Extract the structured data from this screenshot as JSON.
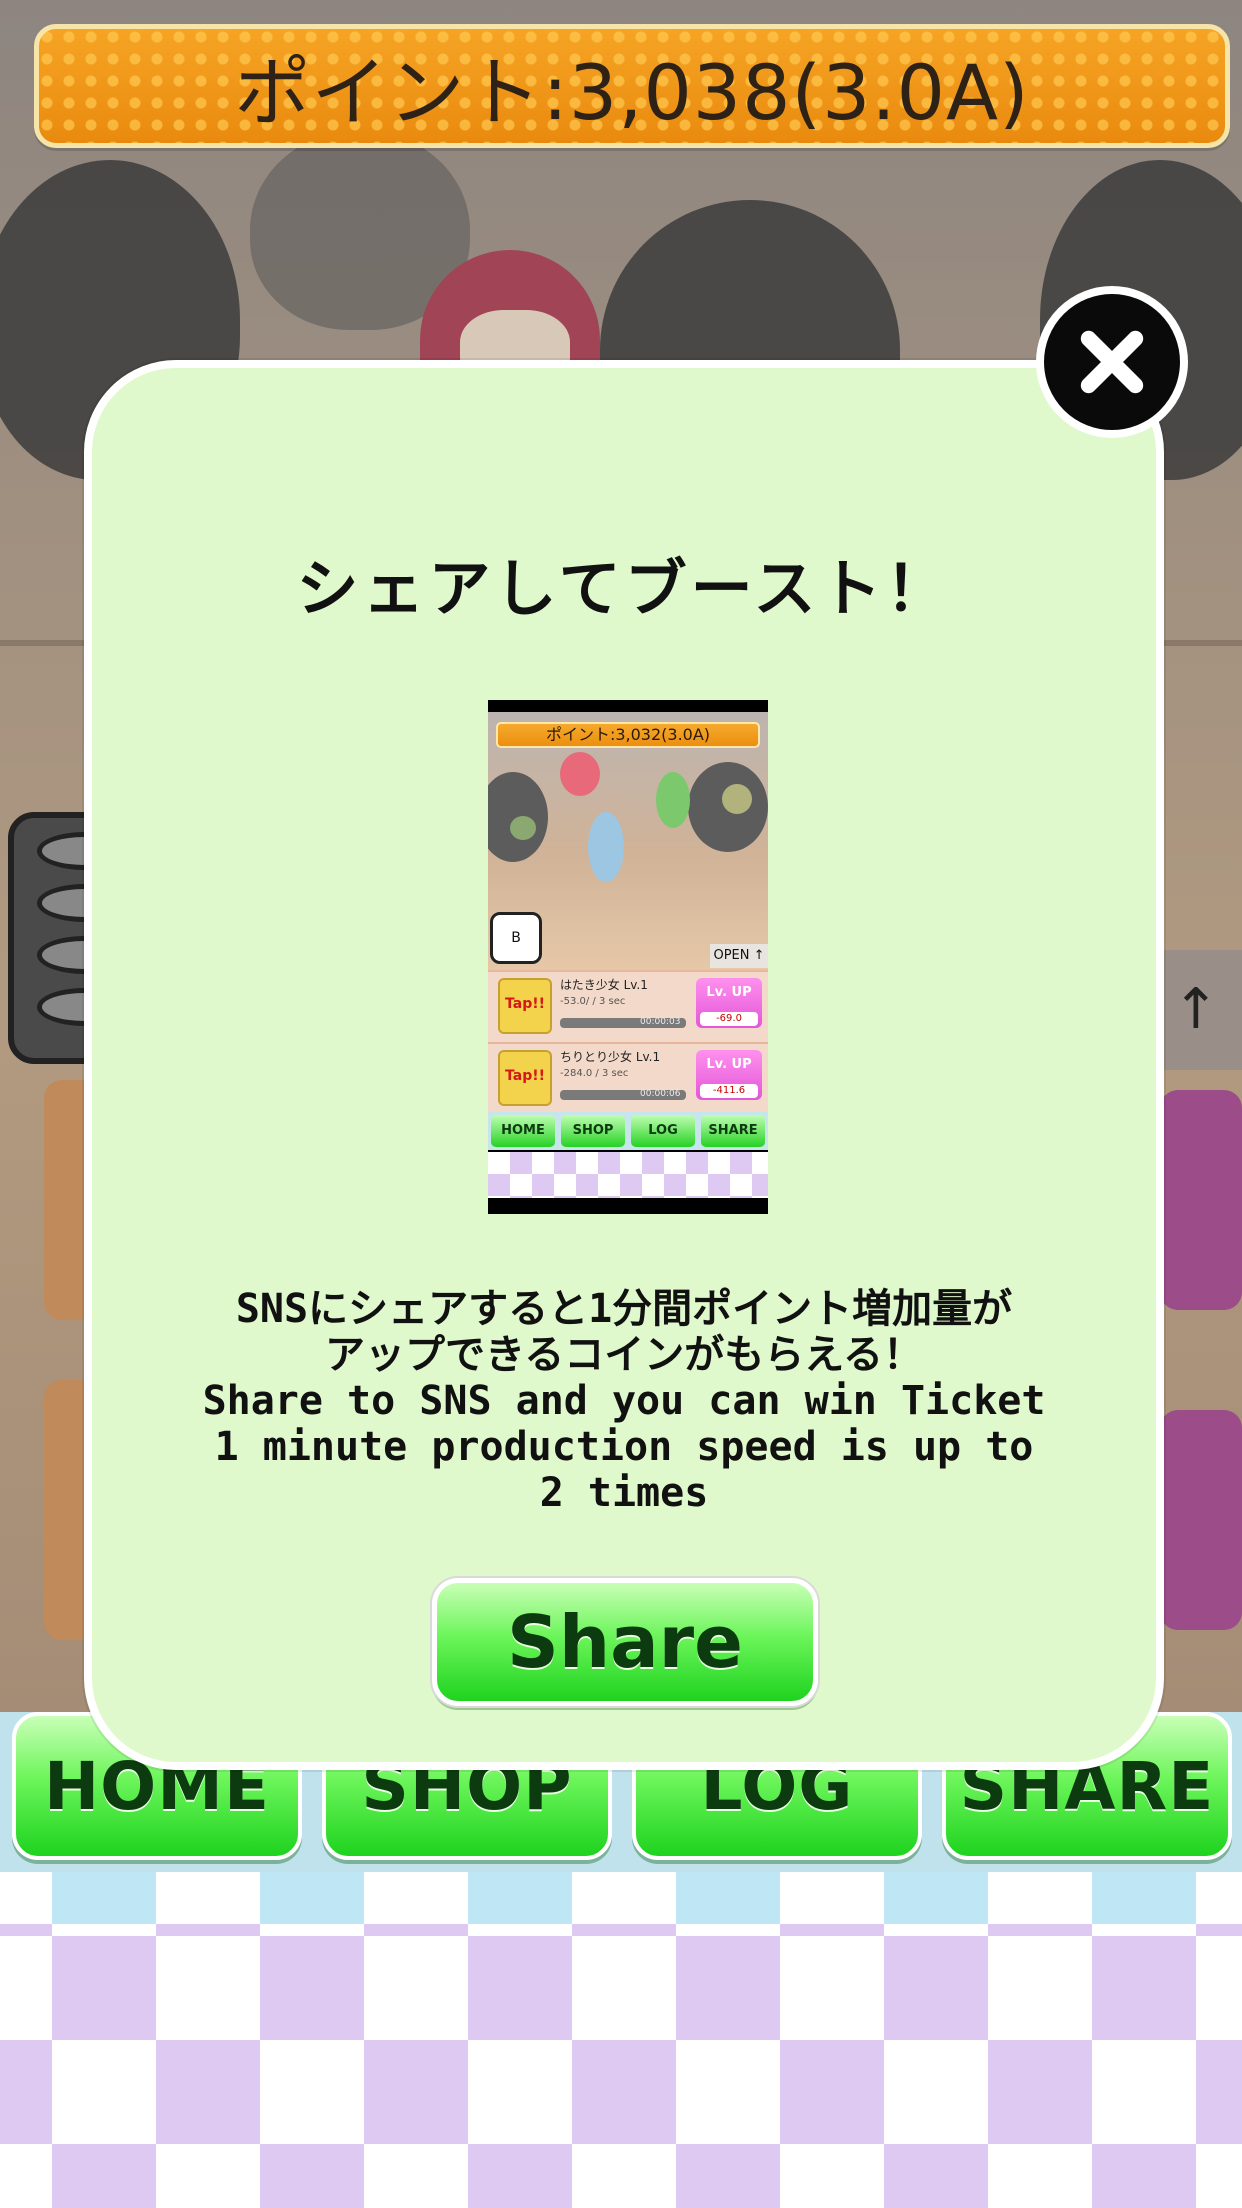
{
  "header": {
    "points_text": "ポイント:3,038(3.0A)"
  },
  "modal": {
    "title": "シェアしてブースト！",
    "description": "SNSにシェアすると1分間ポイント増加量が\nアップできるコインがもらえる！\nShare to SNS and you can win Ticket\n1 minute production speed is up to\n2 times",
    "share_label": "Share",
    "close_icon": "close-icon"
  },
  "preview": {
    "points_text": "ポイント:3,032(3.0A)",
    "coin_label": "B",
    "open_label": "OPEN ↑",
    "rows": [
      {
        "tap": "Tap!!",
        "name": "はたき少女 Lv.1",
        "sub": "-53.0/ / 3 sec",
        "time": "00:00:03",
        "lv": "Lv. UP",
        "cost": "-69.0"
      },
      {
        "tap": "Tap!!",
        "name": "ちりとり少女 Lv.1",
        "sub": "-284.0 / 3 sec",
        "time": "00:00:06",
        "lv": "Lv. UP",
        "cost": "-411.6"
      }
    ],
    "nav": [
      "HOME",
      "SHOP",
      "LOG",
      "SHARE"
    ]
  },
  "bottom_nav": {
    "items": [
      {
        "label": "HOME"
      },
      {
        "label": "SHOP"
      },
      {
        "label": "LOG"
      },
      {
        "label": "SHARE"
      }
    ]
  },
  "scene": {
    "arrow_label": "↑"
  },
  "colors": {
    "accent_orange": "#ee9214",
    "button_green": "#1fd31f",
    "modal_bg": "#dff8cc",
    "lv_pink": "#e256d8"
  }
}
